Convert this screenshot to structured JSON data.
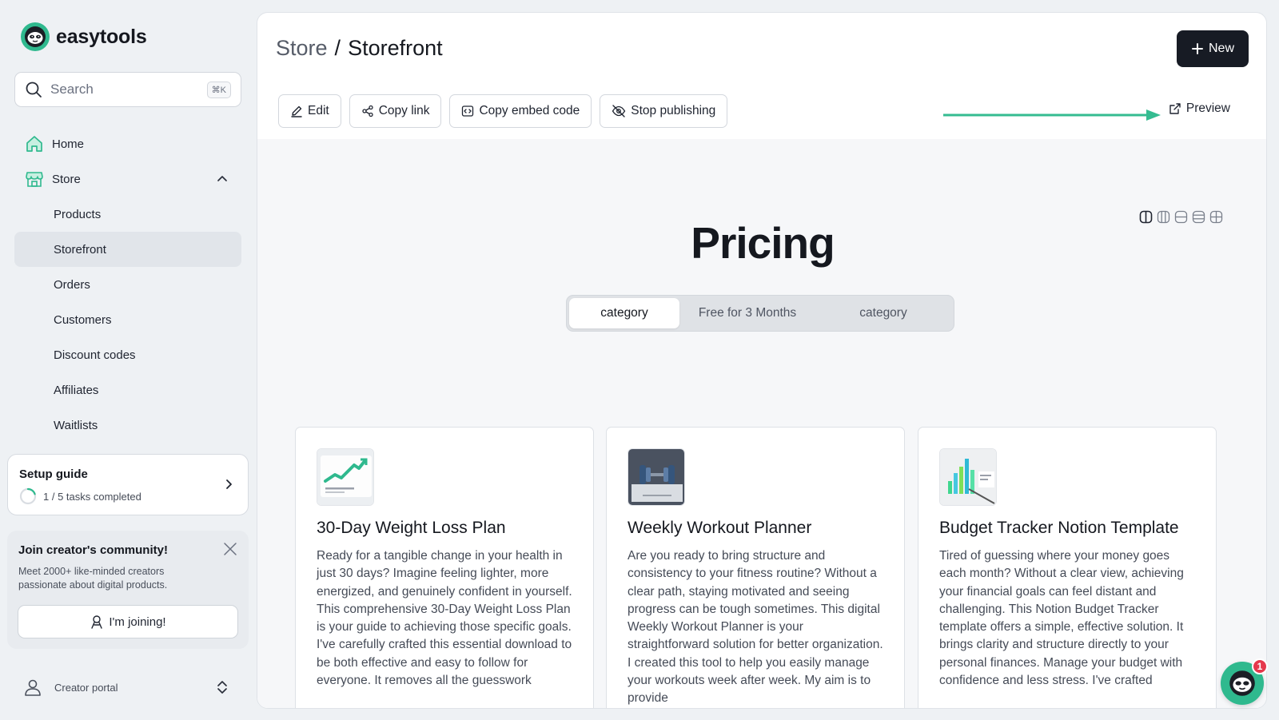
{
  "brand": {
    "name": "easytools",
    "accent": "#2fb98e"
  },
  "search": {
    "placeholder": "Search",
    "shortcut": "⌘K"
  },
  "nav": {
    "home": "Home",
    "store": "Store",
    "sub_items": [
      "Products",
      "Storefront",
      "Orders",
      "Customers",
      "Discount codes",
      "Affiliates",
      "Waitlists"
    ],
    "active": "Storefront"
  },
  "setup_guide": {
    "title": "Setup guide",
    "progress_text": "1 / 5 tasks completed",
    "progress": 0.2
  },
  "community": {
    "title": "Join creator's community!",
    "description": "Meet 2000+ like-minded creators passionate about digital products.",
    "button": "I'm joining!"
  },
  "portal": {
    "label": "Creator portal"
  },
  "header": {
    "crumb_parent": "Store",
    "separator": "/",
    "crumb_current": "Storefront",
    "new_button": "New"
  },
  "toolbar": {
    "edit": "Edit",
    "copy_link": "Copy link",
    "copy_embed": "Copy embed code",
    "stop_publishing": "Stop publishing",
    "preview": "Preview"
  },
  "storefront": {
    "title": "Pricing",
    "tabs": [
      "category",
      "Free for 3 Months",
      "category"
    ],
    "active_tab": 0,
    "products": [
      {
        "title": "30-Day Weight Loss Plan",
        "description": "Ready for a tangible change in your health in just 30 days? Imagine feeling lighter, more energized, and genuinely confident in yourself. This comprehensive 30-Day Weight Loss Plan is your guide to achieving those specific goals. I've carefully crafted this essential download to be both effective and easy to follow for everyone. It removes all the guesswork"
      },
      {
        "title": "Weekly Workout Planner",
        "description": "Are you ready to bring structure and consistency to your fitness routine? Without a clear path, staying motivated and seeing progress can be tough sometimes. This digital Weekly Workout Planner is your straightforward solution for better organization. I created this tool to help you easily manage your workouts week after week. My aim is to provide"
      },
      {
        "title": "Budget Tracker Notion Template",
        "description": "Tired of guessing where your money goes each month? Without a clear view, achieving your financial goals can feel distant and challenging. This Notion Budget Tracker template offers a simple, effective solution. It brings clarity and structure directly to your personal finances. Manage your budget with confidence and less stress. I've crafted"
      }
    ]
  },
  "chat": {
    "badge": "1"
  }
}
